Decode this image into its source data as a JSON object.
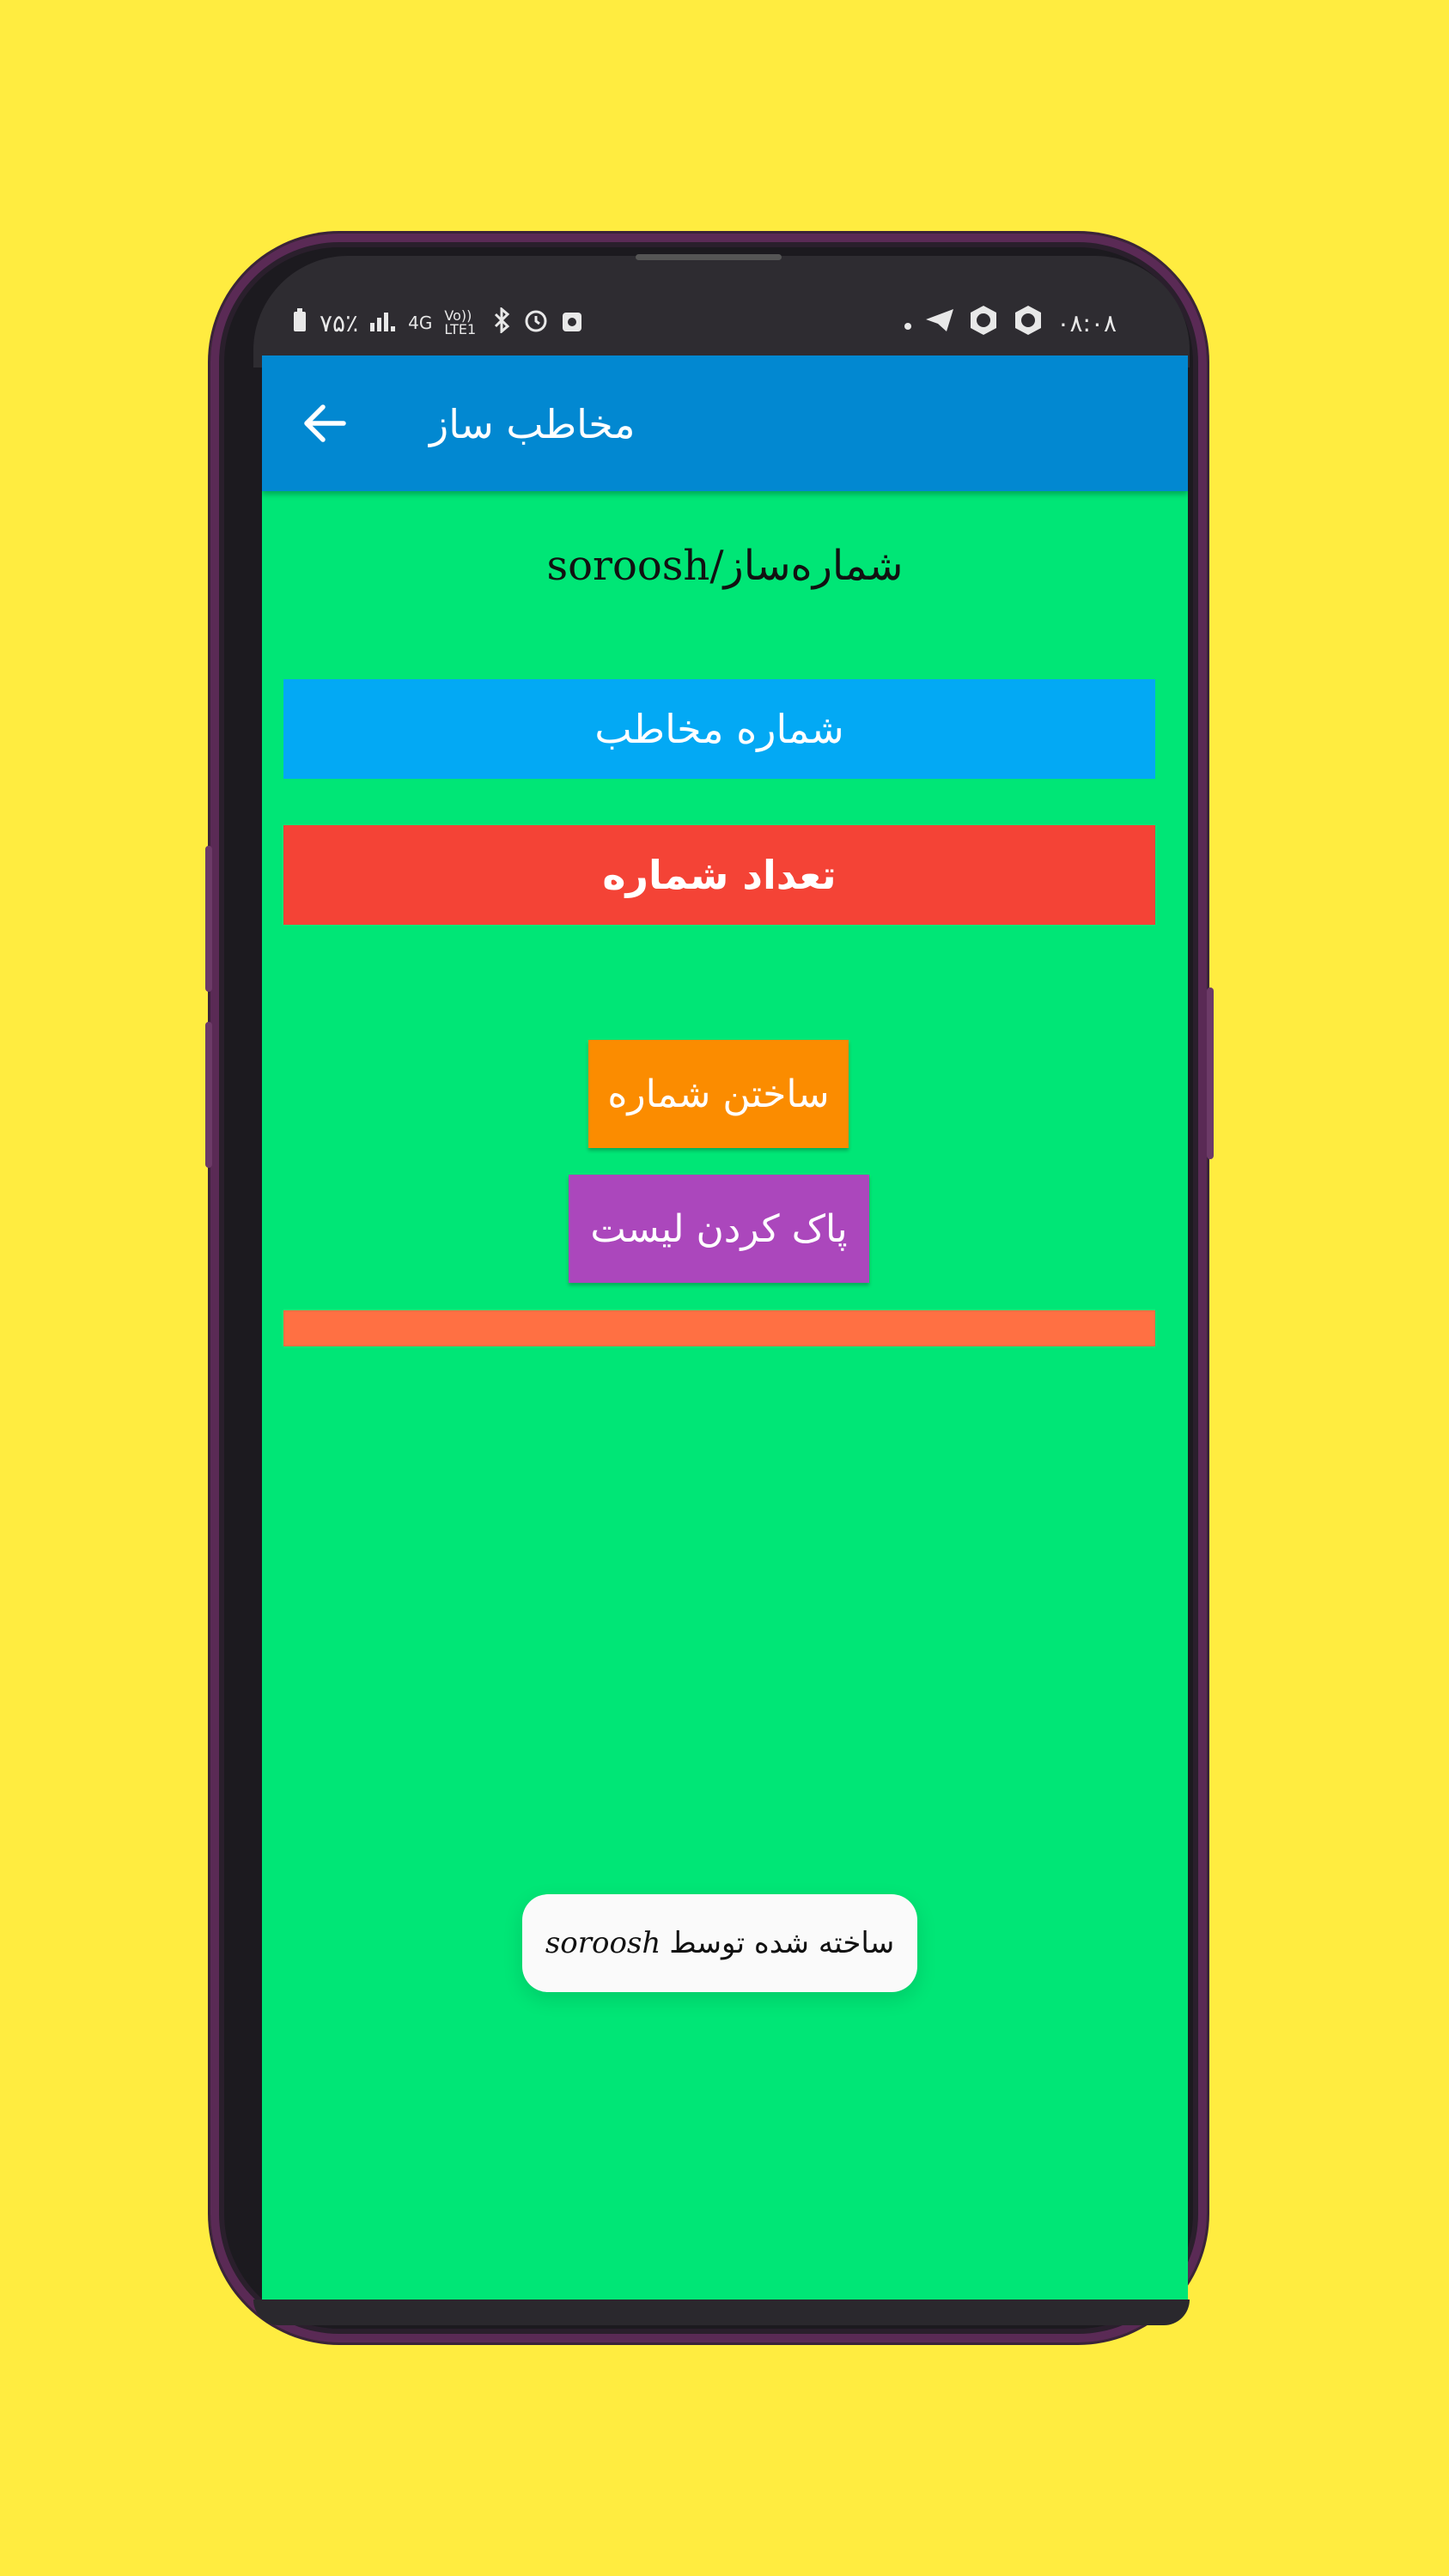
{
  "status_bar": {
    "left_text": "٧۵٪",
    "network": "4G",
    "volte": "Vo)) LTE1",
    "time": "۰۸:۰۸",
    "icons": [
      "battery-icon",
      "signal-icon",
      "bluetooth-icon",
      "alarm-icon",
      "notification-icon",
      "dot-icon",
      "telegram-icon",
      "app-icon",
      "app-icon"
    ]
  },
  "app_bar": {
    "title": "مخاطب ساز",
    "back_icon": "arrow-left-icon",
    "background": "#0288d1"
  },
  "subtitle": "شماره‌ساز/soroosh",
  "fields": {
    "contact_number": "شماره مخاطب",
    "number_count": "تعداد شماره"
  },
  "buttons": {
    "build": "ساختن شماره",
    "clear": "پاک کردن لیست"
  },
  "toast": {
    "text": "ساخته شده توسط",
    "author": "soroosh"
  },
  "colors": {
    "page_background": "#ffec40",
    "screen_background": "#00e676",
    "contact_field": "#03a9f4",
    "count_field": "#f44336",
    "build_button": "#fb8c00",
    "clear_button": "#ab47bc",
    "progress_bar": "#ff7043"
  }
}
